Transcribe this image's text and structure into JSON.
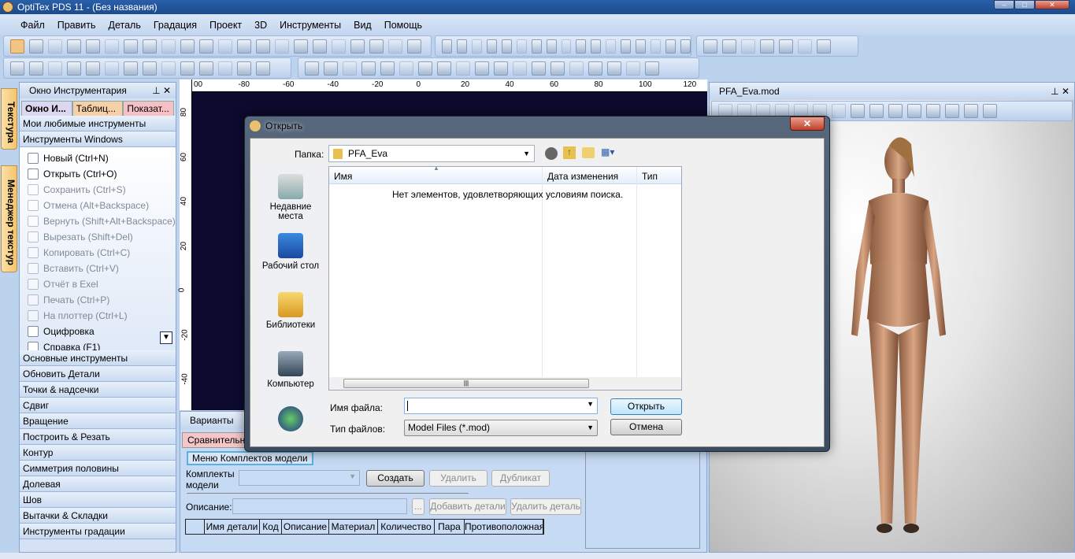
{
  "title": "OptiTex PDS 11 - (Без названия)",
  "menu": [
    "Файл",
    "Править",
    "Деталь",
    "Градация",
    "Проект",
    "3D",
    "Инструменты",
    "Вид",
    "Помощь"
  ],
  "vtabs": [
    "Текстура",
    "Менеджер текстур"
  ],
  "toolpanel": {
    "title": "Окно Инструментария",
    "tabs": [
      "Окно И...",
      "Таблиц...",
      "Показат..."
    ],
    "sections_top": [
      "Мои любимые инструменты",
      "Инструменты Windows"
    ],
    "items": [
      {
        "label": "Новый (Ctrl+N)",
        "enabled": true
      },
      {
        "label": "Открыть (Ctrl+O)",
        "enabled": true
      },
      {
        "label": "Сохранить (Ctrl+S)",
        "enabled": false
      },
      {
        "label": "Отмена (Alt+Backspace)",
        "enabled": false
      },
      {
        "label": "Вернуть (Shift+Alt+Backspace)",
        "enabled": false
      },
      {
        "label": "Вырезать (Shift+Del)",
        "enabled": false
      },
      {
        "label": "Копировать (Ctrl+C)",
        "enabled": false
      },
      {
        "label": "Вставить (Ctrl+V)",
        "enabled": false
      },
      {
        "label": "Отчёт в Exel",
        "enabled": false
      },
      {
        "label": "Печать (Ctrl+P)",
        "enabled": false
      },
      {
        "label": "На плоттер (Ctrl+L)",
        "enabled": false
      },
      {
        "label": "Оцифровка",
        "enabled": true
      },
      {
        "label": "Справка (F1)",
        "enabled": true
      }
    ],
    "sections_bottom": [
      "Основные инструменты",
      "Обновить Детали",
      "Точки & надсечки",
      "Сдвиг",
      "Вращение",
      "Построить & Резать",
      "Контур",
      "Симметрия половины",
      "Долевая",
      "Шов",
      "Вытачки & Складки",
      "Инструменты градации"
    ]
  },
  "ruler": {
    "h": [
      "00",
      "-80",
      "-60",
      "-40",
      "-20",
      "0",
      "20",
      "40",
      "60",
      "80",
      "100",
      "120"
    ],
    "v": [
      "80",
      "60",
      "40",
      "20",
      "0",
      "-20",
      "-40"
    ]
  },
  "variants": {
    "title": "Варианты",
    "tab": "Сравнительн",
    "menu_button": "Меню Комплектов модели",
    "sets_label": "Комплекты модели",
    "create": "Создать",
    "delete": "Удалить",
    "duplicate": "Дубликат",
    "desc_label": "Описание:",
    "ellipsis": "...",
    "add_parts": "Добавить детали",
    "remove_part": "Удалить деталь",
    "columns": [
      "",
      "Имя детали",
      "Код",
      "Описание",
      "Материал",
      "Количество",
      "Пара",
      "Противоположная"
    ]
  },
  "view3d": {
    "title": "PFA_Eva.mod"
  },
  "dialog": {
    "title": "Открыть",
    "folder_label": "Папка:",
    "folder": "PFA_Eva",
    "places": [
      "Недавние места",
      "Рабочий стол",
      "Библиотеки",
      "Компьютер",
      ""
    ],
    "columns": [
      "Имя",
      "Дата изменения",
      "Тип"
    ],
    "empty": "Нет элементов, удовлетворяющих условиям поиска.",
    "filename_label": "Имя файла:",
    "filename": "",
    "filetype_label": "Тип файлов:",
    "filetype": "Model Files (*.mod)",
    "open": "Открыть",
    "cancel": "Отмена"
  }
}
